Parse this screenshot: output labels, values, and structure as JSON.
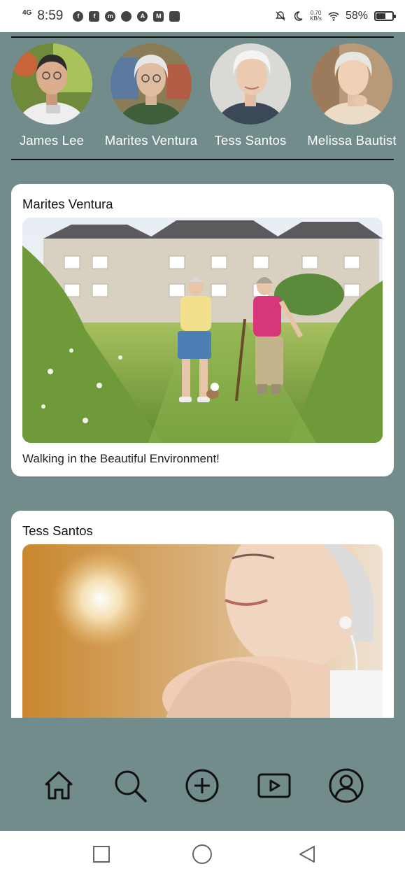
{
  "status_bar": {
    "network": "4G",
    "time": "8:59",
    "app_icons": [
      "facebook-circle-icon",
      "facebook-square-icon",
      "messenger-icon",
      "leaf-icon",
      "app-a-icon",
      "gmail-icon",
      "recorder-icon"
    ],
    "app_glyphs": [
      "f",
      "f",
      "m",
      "",
      "A",
      "M",
      ""
    ],
    "speed_value": "0.70",
    "speed_unit": "KB/s",
    "battery_percent": "58%",
    "battery_level": 0.58
  },
  "stories": [
    {
      "name": "James Lee",
      "avatar": "avatar-james-lee"
    },
    {
      "name": "Marites Ventura",
      "avatar": "avatar-marites-ventura"
    },
    {
      "name": "Tess Santos",
      "avatar": "avatar-tess-santos"
    },
    {
      "name": "Melissa Bautist",
      "avatar": "avatar-melissa-bautista"
    }
  ],
  "posts": [
    {
      "author": "Marites Ventura",
      "caption": "Walking in the Beautiful Environment!"
    },
    {
      "author": "Tess Santos",
      "caption": ""
    }
  ],
  "bottom_nav": [
    "home-icon",
    "search-icon",
    "add-post-icon",
    "video-icon",
    "profile-icon"
  ],
  "system_nav": [
    "recent-apps-icon",
    "home-circle-icon",
    "back-icon"
  ],
  "colors": {
    "background": "#728c8c",
    "card": "#ffffff",
    "icon": "#111111"
  }
}
